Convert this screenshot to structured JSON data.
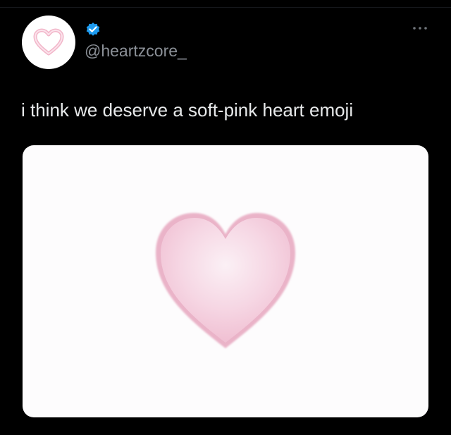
{
  "tweet": {
    "author": {
      "handle": "@heartzcore_",
      "verified": true,
      "avatar_icon": "pink-heart-outline-icon"
    },
    "text": "i think we deserve a soft-pink heart emoji",
    "media": {
      "type": "image",
      "content_icon": "soft-pink-heart-emoji"
    },
    "more_icon": "more-horizontal-icon"
  },
  "colors": {
    "background": "#000000",
    "text_primary": "#e7e9ea",
    "text_secondary": "#8b9097",
    "verified_blue": "#1d9bf0",
    "heart_fill": "#f4cede",
    "heart_edge": "#eab3c8",
    "media_bg": "#fdfcfd"
  }
}
